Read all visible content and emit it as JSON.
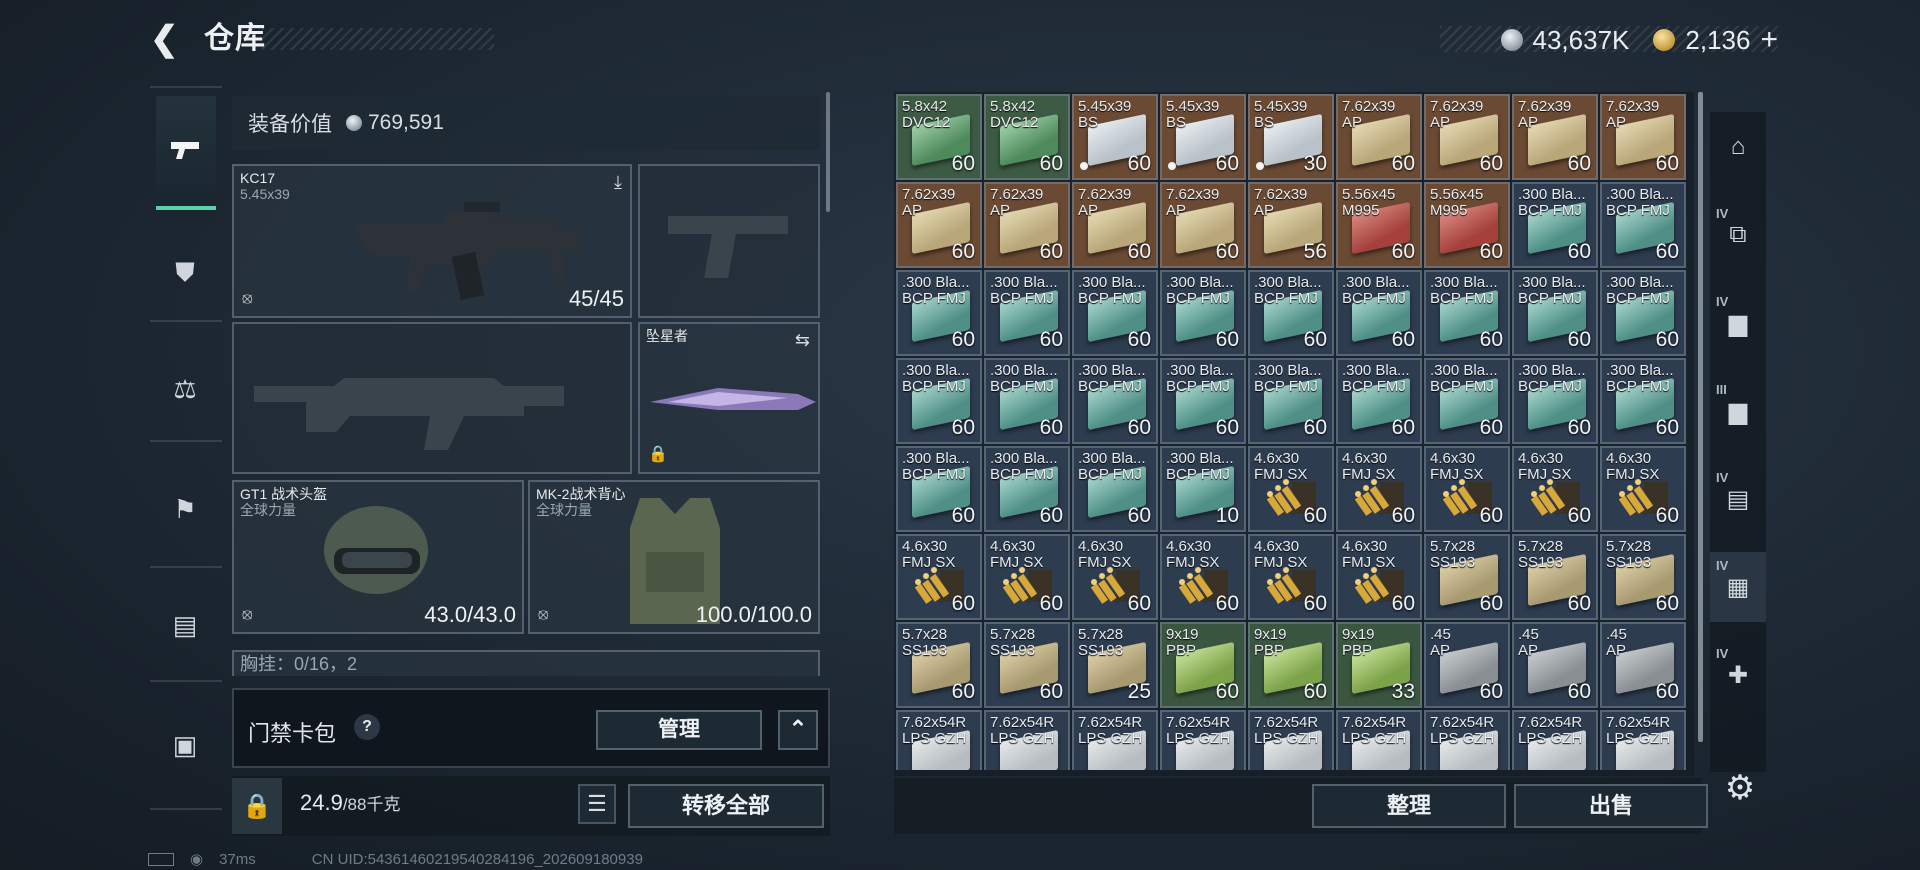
{
  "header": {
    "back_icon": "chevron-left-icon",
    "title": "仓库",
    "silver_amount": "43,637K",
    "gold_amount": "2,136",
    "add_label": "+"
  },
  "rail": {
    "items": [
      "pistol-icon",
      "vest-icon",
      "medkit-icon",
      "backpack-icon",
      "storage-icon",
      "briefcase-icon"
    ]
  },
  "equipment": {
    "value_label": "装备价值",
    "value": "769,591",
    "primary_weapon": {
      "name": "KC17",
      "caliber": "5.45x39",
      "ammo": "45/45"
    },
    "melee": {
      "name": "坠星者"
    },
    "helmet": {
      "name": "GT1 战术头盔",
      "faction": "全球力量",
      "durability": "43.0/43.0"
    },
    "vest": {
      "name": "MK-2战术背心",
      "faction": "全球力量",
      "durability": "100.0/100.0"
    },
    "chest_rig_label": "胸挂：0/16，2"
  },
  "keycard": {
    "label": "门禁卡包",
    "help": "?",
    "manage_label": "管理",
    "collapse_label": "^"
  },
  "weight": {
    "current": "24.9",
    "max": "/88千克"
  },
  "actions": {
    "transfer_all": "转移全部",
    "organize": "整理",
    "sell": "出售"
  },
  "status": {
    "ping": "37ms",
    "uid": "CN UID:5436146021954028419​6_202609180939"
  },
  "stash": {
    "rows": [
      [
        {
          "l1": "5.8x42",
          "l2": "DVC12",
          "n": "60",
          "k": "box-green"
        },
        {
          "l1": "5.8x42",
          "l2": "DVC12",
          "n": "60",
          "k": "box-green"
        },
        {
          "l1": "5.45x39",
          "l2": "BS",
          "n": "60",
          "k": "box-white",
          "dot": true
        },
        {
          "l1": "5.45x39",
          "l2": "BS",
          "n": "60",
          "k": "box-white",
          "dot": true
        },
        {
          "l1": "5.45x39",
          "l2": "BS",
          "n": "30",
          "k": "box-white",
          "dot": true
        },
        {
          "l1": "7.62x39",
          "l2": "AP",
          "n": "60",
          "k": "box-tan"
        },
        {
          "l1": "7.62x39",
          "l2": "AP",
          "n": "60",
          "k": "box-tan"
        },
        {
          "l1": "7.62x39",
          "l2": "AP",
          "n": "60",
          "k": "box-tan"
        },
        {
          "l1": "7.62x39",
          "l2": "AP",
          "n": "60",
          "k": "box-tan"
        }
      ],
      [
        {
          "l1": "7.62x39",
          "l2": "AP",
          "n": "60",
          "k": "box-tan"
        },
        {
          "l1": "7.62x39",
          "l2": "AP",
          "n": "60",
          "k": "box-tan"
        },
        {
          "l1": "7.62x39",
          "l2": "AP",
          "n": "60",
          "k": "box-tan"
        },
        {
          "l1": "7.62x39",
          "l2": "AP",
          "n": "60",
          "k": "box-tan"
        },
        {
          "l1": "7.62x39",
          "l2": "AP",
          "n": "56",
          "k": "box-tan"
        },
        {
          "l1": "5.56x45",
          "l2": "M995",
          "n": "60",
          "k": "box-red"
        },
        {
          "l1": "5.56x45",
          "l2": "M995",
          "n": "60",
          "k": "box-red"
        },
        {
          "l1": ".300 Bla...",
          "l2": "BCP FMJ",
          "n": "60",
          "k": "box-teal"
        },
        {
          "l1": ".300 Bla...",
          "l2": "BCP FMJ",
          "n": "60",
          "k": "box-teal"
        }
      ],
      [
        {
          "l1": ".300 Bla...",
          "l2": "BCP FMJ",
          "n": "60",
          "k": "box-teal"
        },
        {
          "l1": ".300 Bla...",
          "l2": "BCP FMJ",
          "n": "60",
          "k": "box-teal"
        },
        {
          "l1": ".300 Bla...",
          "l2": "BCP FMJ",
          "n": "60",
          "k": "box-teal"
        },
        {
          "l1": ".300 Bla...",
          "l2": "BCP FMJ",
          "n": "60",
          "k": "box-teal"
        },
        {
          "l1": ".300 Bla...",
          "l2": "BCP FMJ",
          "n": "60",
          "k": "box-teal"
        },
        {
          "l1": ".300 Bla...",
          "l2": "BCP FMJ",
          "n": "60",
          "k": "box-teal"
        },
        {
          "l1": ".300 Bla...",
          "l2": "BCP FMJ",
          "n": "60",
          "k": "box-teal"
        },
        {
          "l1": ".300 Bla...",
          "l2": "BCP FMJ",
          "n": "60",
          "k": "box-teal"
        },
        {
          "l1": ".300 Bla...",
          "l2": "BCP FMJ",
          "n": "60",
          "k": "box-teal"
        }
      ],
      [
        {
          "l1": ".300 Bla...",
          "l2": "BCP FMJ",
          "n": "60",
          "k": "box-teal"
        },
        {
          "l1": ".300 Bla...",
          "l2": "BCP FMJ",
          "n": "60",
          "k": "box-teal"
        },
        {
          "l1": ".300 Bla...",
          "l2": "BCP FMJ",
          "n": "60",
          "k": "box-teal"
        },
        {
          "l1": ".300 Bla...",
          "l2": "BCP FMJ",
          "n": "60",
          "k": "box-teal"
        },
        {
          "l1": ".300 Bla...",
          "l2": "BCP FMJ",
          "n": "60",
          "k": "box-teal"
        },
        {
          "l1": ".300 Bla...",
          "l2": "BCP FMJ",
          "n": "60",
          "k": "box-teal"
        },
        {
          "l1": ".300 Bla...",
          "l2": "BCP FMJ",
          "n": "60",
          "k": "box-teal"
        },
        {
          "l1": ".300 Bla...",
          "l2": "BCP FMJ",
          "n": "60",
          "k": "box-teal"
        },
        {
          "l1": ".300 Bla...",
          "l2": "BCP FMJ",
          "n": "60",
          "k": "box-teal"
        }
      ],
      [
        {
          "l1": ".300 Bla...",
          "l2": "BCP FMJ",
          "n": "60",
          "k": "box-teal"
        },
        {
          "l1": ".300 Bla...",
          "l2": "BCP FMJ",
          "n": "60",
          "k": "box-teal"
        },
        {
          "l1": ".300 Bla...",
          "l2": "BCP FMJ",
          "n": "60",
          "k": "box-teal"
        },
        {
          "l1": ".300 Bla...",
          "l2": "BCP FMJ",
          "n": "10",
          "k": "box-teal"
        },
        {
          "l1": "4.6x30",
          "l2": "FMJ SX",
          "n": "60",
          "k": "rounds"
        },
        {
          "l1": "4.6x30",
          "l2": "FMJ SX",
          "n": "60",
          "k": "rounds"
        },
        {
          "l1": "4.6x30",
          "l2": "FMJ SX",
          "n": "60",
          "k": "rounds"
        },
        {
          "l1": "4.6x30",
          "l2": "FMJ SX",
          "n": "60",
          "k": "rounds"
        },
        {
          "l1": "4.6x30",
          "l2": "FMJ SX",
          "n": "60",
          "k": "rounds"
        }
      ],
      [
        {
          "l1": "4.6x30",
          "l2": "FMJ SX",
          "n": "60",
          "k": "rounds"
        },
        {
          "l1": "4.6x30",
          "l2": "FMJ SX",
          "n": "60",
          "k": "rounds"
        },
        {
          "l1": "4.6x30",
          "l2": "FMJ SX",
          "n": "60",
          "k": "rounds"
        },
        {
          "l1": "4.6x30",
          "l2": "FMJ SX",
          "n": "60",
          "k": "rounds"
        },
        {
          "l1": "4.6x30",
          "l2": "FMJ SX",
          "n": "60",
          "k": "rounds"
        },
        {
          "l1": "4.6x30",
          "l2": "FMJ SX",
          "n": "60",
          "k": "rounds"
        },
        {
          "l1": "5.7x28",
          "l2": "SS193",
          "n": "60",
          "k": "box-sand"
        },
        {
          "l1": "5.7x28",
          "l2": "SS193",
          "n": "60",
          "k": "box-sand"
        },
        {
          "l1": "5.7x28",
          "l2": "SS193",
          "n": "60",
          "k": "box-sand"
        }
      ],
      [
        {
          "l1": "5.7x28",
          "l2": "SS193",
          "n": "60",
          "k": "box-sand"
        },
        {
          "l1": "5.7x28",
          "l2": "SS193",
          "n": "60",
          "k": "box-sand"
        },
        {
          "l1": "5.7x28",
          "l2": "SS193",
          "n": "25",
          "k": "box-sand"
        },
        {
          "l1": "9x19",
          "l2": "PBP",
          "n": "60",
          "k": "box-lime"
        },
        {
          "l1": "9x19",
          "l2": "PBP",
          "n": "60",
          "k": "box-lime"
        },
        {
          "l1": "9x19",
          "l2": "PBP",
          "n": "33",
          "k": "box-lime"
        },
        {
          "l1": ".45",
          "l2": "AP",
          "n": "60",
          "k": "box-grey"
        },
        {
          "l1": ".45",
          "l2": "AP",
          "n": "60",
          "k": "box-grey"
        },
        {
          "l1": ".45",
          "l2": "AP",
          "n": "60",
          "k": "box-grey"
        }
      ],
      [
        {
          "l1": "7.62x54R",
          "l2": "LPS GZH",
          "n": "",
          "k": "box-light"
        },
        {
          "l1": "7.62x54R",
          "l2": "LPS GZH",
          "n": "",
          "k": "box-light"
        },
        {
          "l1": "7.62x54R",
          "l2": "LPS GZH",
          "n": "",
          "k": "box-light"
        },
        {
          "l1": "7.62x54R",
          "l2": "LPS GZH",
          "n": "",
          "k": "box-light"
        },
        {
          "l1": "7.62x54R",
          "l2": "LPS GZH",
          "n": "",
          "k": "box-light"
        },
        {
          "l1": "7.62x54R",
          "l2": "LPS GZH",
          "n": "",
          "k": "box-light"
        },
        {
          "l1": "7.62x54R",
          "l2": "LPS GZH",
          "n": "",
          "k": "box-light"
        },
        {
          "l1": "7.62x54R",
          "l2": "LPS GZH",
          "n": "",
          "k": "box-light"
        },
        {
          "l1": "7.62x54R",
          "l2": "LPS GZH",
          "n": "",
          "k": "box-light"
        }
      ]
    ]
  },
  "containers": [
    {
      "level": "",
      "icon": "safe-case-icon"
    },
    {
      "level": "IV",
      "icon": "ammo-case-icon"
    },
    {
      "level": "IV",
      "icon": "weapon-case-icon"
    },
    {
      "level": "III",
      "icon": "weapon-case-icon"
    },
    {
      "level": "IV",
      "icon": "document-case-icon"
    },
    {
      "level": "IV",
      "icon": "folder-case-icon"
    },
    {
      "level": "IV",
      "icon": "medical-case-icon"
    }
  ],
  "settings_icon": "gear-icon",
  "colors": {
    "cell_brown": "#6e4c33",
    "cell_green": "#3a5340",
    "cell_blue": "#2f3e52",
    "accent": "#5ad1a9"
  }
}
